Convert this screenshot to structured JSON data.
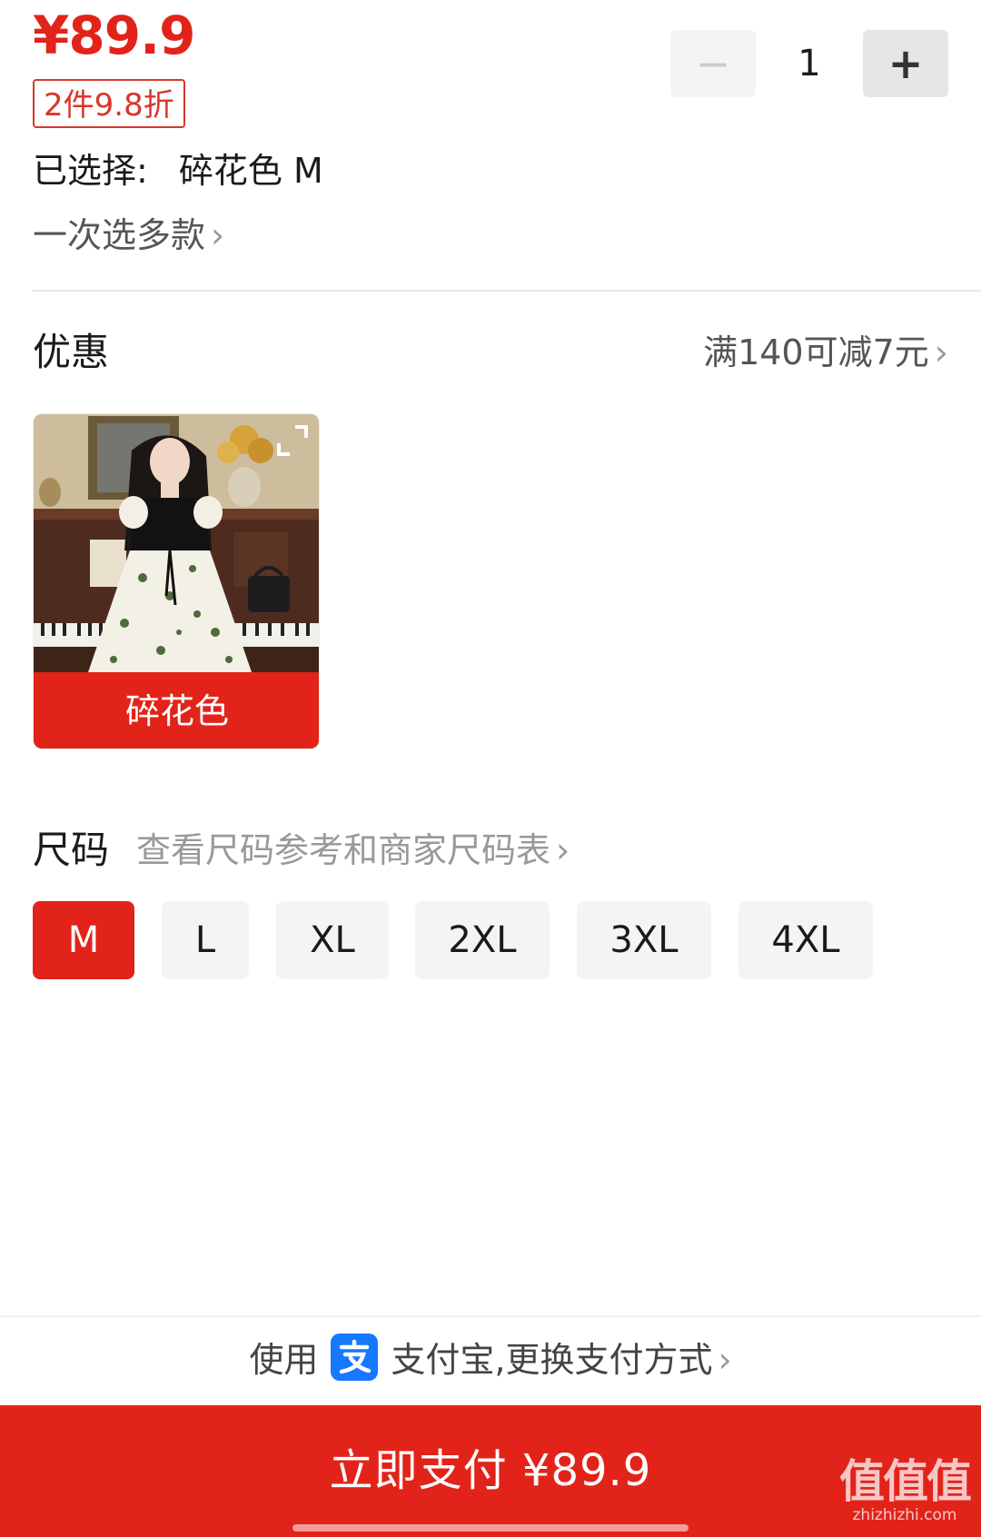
{
  "product": {
    "price": "¥89.9",
    "discount_tag": "2件9.8折"
  },
  "quantity": {
    "minus_label": "−",
    "value": "1",
    "plus_label": "+"
  },
  "selection": {
    "label": "已选择:",
    "value": "碎花色 M"
  },
  "multi_select": {
    "label": "一次选多款",
    "chevron": "›"
  },
  "promotion": {
    "title": "优惠",
    "value": "满140可减7元",
    "chevron": "›"
  },
  "colors": {
    "options": [
      {
        "label": "碎花色",
        "selected": true
      }
    ]
  },
  "size": {
    "title": "尺码",
    "guide_link": "查看尺码参考和商家尺码表",
    "guide_chevron": "›",
    "options": [
      {
        "label": "M",
        "selected": true
      },
      {
        "label": "L",
        "selected": false
      },
      {
        "label": "XL",
        "selected": false
      },
      {
        "label": "2XL",
        "selected": false
      },
      {
        "label": "3XL",
        "selected": false
      },
      {
        "label": "4XL",
        "selected": false
      }
    ]
  },
  "payment": {
    "prefix": "使用",
    "method": "支付宝,更换支付方式",
    "chevron": "›",
    "icon": "alipay-icon",
    "pay_button": "立即支付 ¥89.9"
  },
  "watermark": {
    "mark": "值值值",
    "url": "zhizhizhi.com"
  },
  "colors_theme": {
    "accent": "#e2231a",
    "alipay_blue": "#1677ff"
  }
}
